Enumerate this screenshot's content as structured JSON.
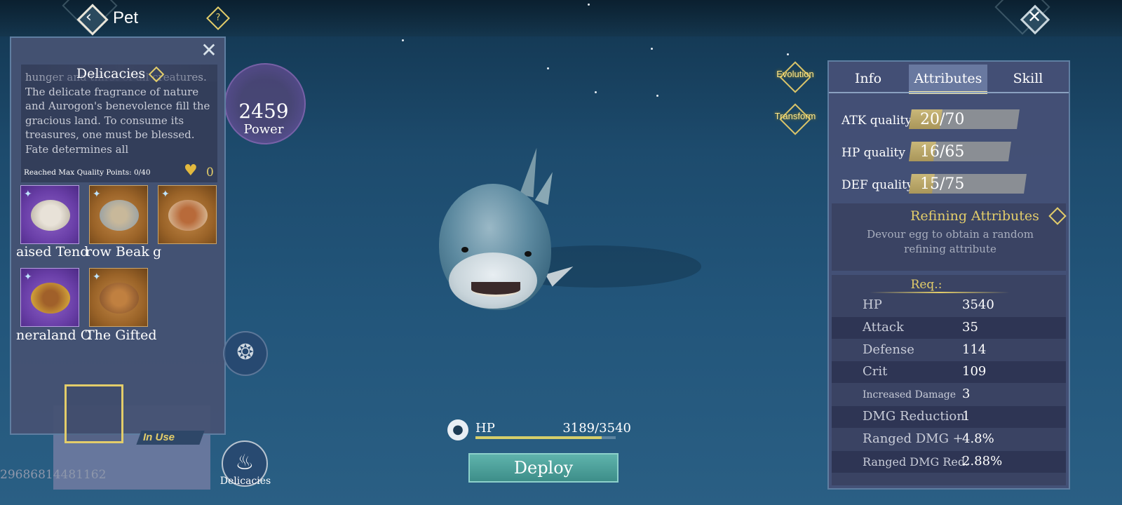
{
  "header": {
    "title": "Pet",
    "help_symbol": "?",
    "back_symbol": "‹",
    "close_symbol": "✕"
  },
  "delicacies_panel": {
    "close_symbol": "✕",
    "title": "Delicacies",
    "description": "hunger and thirst of all creatures. The delicate fragrance of nature and Aurogon's benevolence fill the gracious land. To consume its treasures, one must be blessed. Fate determines all",
    "reach_text": "Reached Max Quality Points: 0/40",
    "heart_count": "0",
    "items_row1_labels": [
      "aised Tend",
      "row Beak",
      "g"
    ],
    "items_row2_labels": [
      "neraland C",
      "The Gifted"
    ],
    "in_use_label": "In Use",
    "uid": "29686814481162"
  },
  "power": {
    "value": "2459",
    "label": "Power"
  },
  "side_buttons": {
    "evolution": "Evolution",
    "transform": "Transform",
    "delicacies": "Delicacies"
  },
  "hp_bar": {
    "label": "HP",
    "value": "3189/3540",
    "fraction": 0.9
  },
  "deploy_label": "Deploy",
  "tabs": [
    "Info",
    "Attributes",
    "Skill"
  ],
  "active_tab": "Attributes",
  "quality": [
    {
      "label": "ATK quality",
      "value": "20/70",
      "fraction": 0.286
    },
    {
      "label": "HP quality",
      "value": "16/65",
      "fraction": 0.246
    },
    {
      "label": "DEF quality",
      "value": "15/75",
      "fraction": 0.2
    }
  ],
  "refining": {
    "title": "Refining Attributes",
    "description": "Devour egg to obtain a random refining attribute"
  },
  "requirements": {
    "title": "Req.:",
    "stats": [
      {
        "name": "HP",
        "value": "3540"
      },
      {
        "name": "Attack",
        "value": "35"
      },
      {
        "name": "Defense",
        "value": "114"
      },
      {
        "name": "Crit",
        "value": "109"
      },
      {
        "name": "Increased Damage",
        "value": "3"
      },
      {
        "name": "DMG Reduction",
        "value": "1"
      },
      {
        "name": "Ranged DMG +",
        "value": "4.8%"
      },
      {
        "name": "Ranged DMG Red.",
        "value": "2.88%"
      }
    ]
  },
  "colors": {
    "gold": "#e3cd6a",
    "panel": "#46527a",
    "deploy": "#4fa09a"
  }
}
